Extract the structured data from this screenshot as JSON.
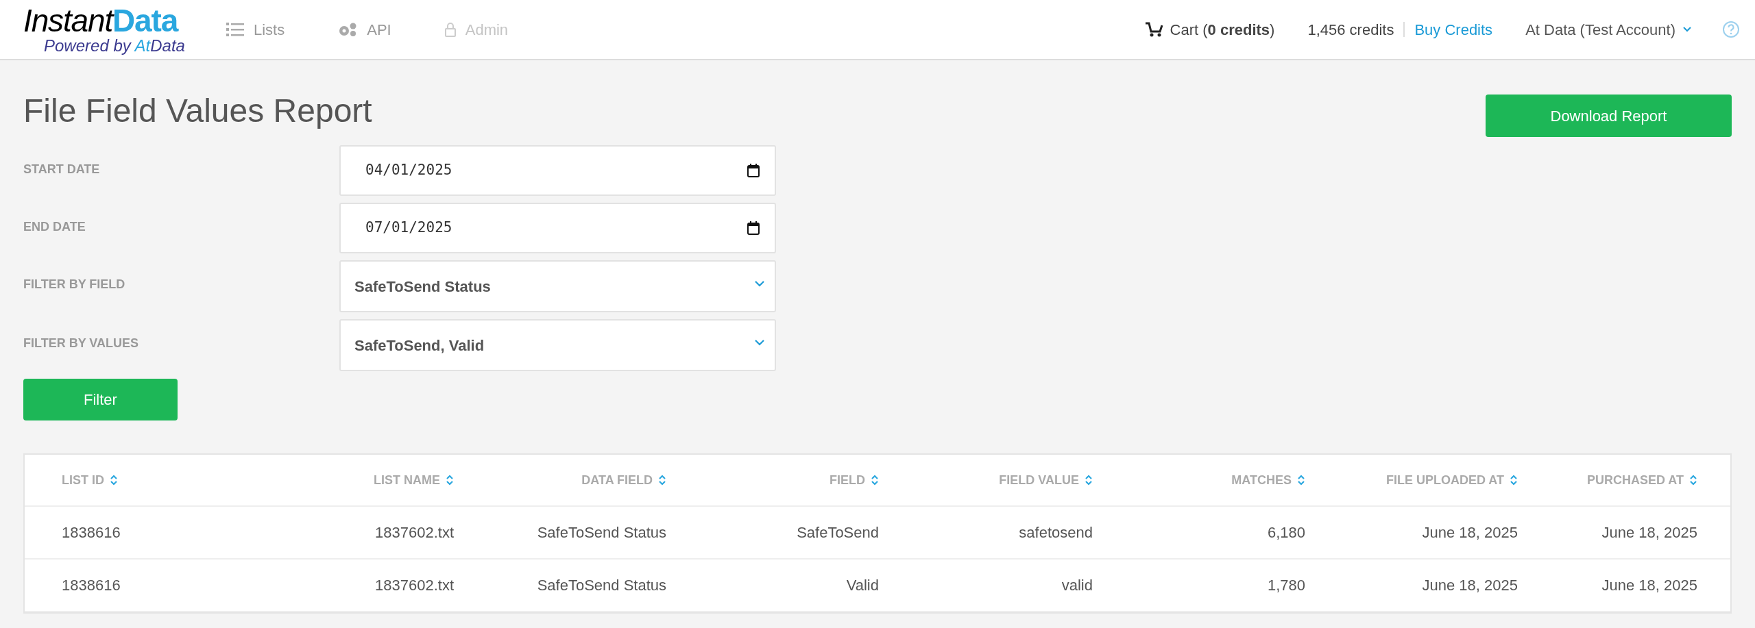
{
  "logo": {
    "word1": "Instant",
    "word2": "Data",
    "tagline": [
      "Powered by ",
      "At",
      "Data"
    ]
  },
  "nav": [
    {
      "label": "Lists",
      "disabled": false
    },
    {
      "label": "API",
      "disabled": false
    },
    {
      "label": "Admin",
      "disabled": true
    }
  ],
  "header": {
    "cart": "Cart (**0 credits**)",
    "credits": "1,456 credits",
    "buy": "Buy Credits",
    "account": "At Data (Test Account)"
  },
  "page": {
    "title": "File Field Values Report",
    "download": "Download Report"
  },
  "form": [
    {
      "label": "START DATE",
      "kind": "date",
      "value": "04/01/2025"
    },
    {
      "label": "END DATE",
      "kind": "date",
      "value": "07/01/2025"
    },
    {
      "label": "FILTER BY FIELD",
      "kind": "select",
      "value": "SafeToSend Status"
    },
    {
      "label": "FILTER BY VALUES",
      "kind": "select",
      "value": "SafeToSend, Valid"
    }
  ],
  "filter_button": "Filter",
  "table": {
    "columns": [
      "LIST ID",
      "LIST NAME",
      "DATA FIELD",
      "FIELD",
      "FIELD VALUE",
      "MATCHES",
      "FILE UPLOADED AT",
      "PURCHASED AT"
    ],
    "rows": [
      [
        "1838616",
        "1837602.txt",
        "SafeToSend Status",
        "SafeToSend",
        "safetosend",
        "6,180",
        "June 18, 2025",
        "June 18, 2025"
      ],
      [
        "1838616",
        "1837602.txt",
        "SafeToSend Status",
        "Valid",
        "valid",
        "1,780",
        "June 18, 2025",
        "June 18, 2025"
      ]
    ]
  }
}
